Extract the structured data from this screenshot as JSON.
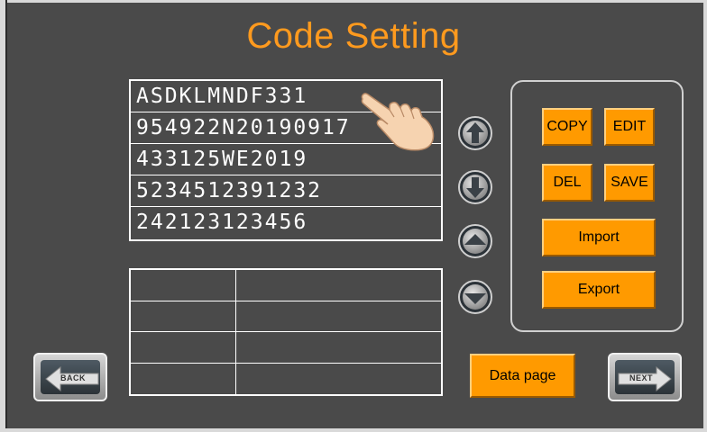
{
  "title": "Code Setting",
  "codes": [
    "ASDKLMNDF331",
    "954922N20190917",
    "433125WE2019",
    "5234512391232",
    "242123123456"
  ],
  "buttons": {
    "copy": "COPY",
    "edit": "EDIT",
    "del": "DEL",
    "save": "SAVE",
    "import": "Import",
    "export": "Export",
    "data_page": "Data page",
    "back": "BACK",
    "next": "NEXT"
  },
  "colors": {
    "accent": "#ff9a00",
    "title": "#ff9a1e",
    "background": "#4a4a4a"
  },
  "icons": [
    "pointing-hand-icon",
    "up-arrow-icon",
    "down-arrow-icon",
    "page-up-icon",
    "page-down-icon",
    "back-arrow-icon",
    "next-arrow-icon"
  ]
}
